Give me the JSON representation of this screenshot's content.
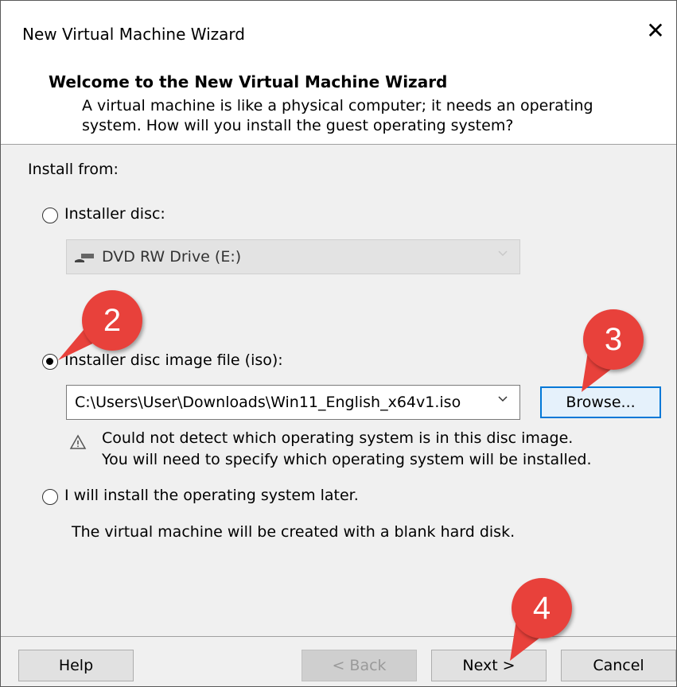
{
  "window": {
    "title": "New Virtual Machine Wizard",
    "close_glyph": "✕"
  },
  "header": {
    "title": "Welcome to the New Virtual Machine Wizard",
    "description_line1": "A virtual machine is like a physical computer; it needs an operating",
    "description_line2": "system. How will you install the guest operating system?"
  },
  "install": {
    "label": "Install from:",
    "options": [
      {
        "label": "Installer disc:",
        "selected": false
      },
      {
        "label": "Installer disc image file (iso):",
        "selected": true
      },
      {
        "label": "I will install the operating system later.",
        "selected": false
      }
    ],
    "disc_drive": {
      "value": "DVD RW Drive (E:)",
      "enabled": false
    },
    "iso_path": {
      "value": "C:\\Users\\User\\Downloads\\Win11_English_x64v1.iso"
    },
    "browse_label": "Browse...",
    "warning_line1": "Could not detect which operating system is in this disc image.",
    "warning_line2": "You will need to specify which operating system will be installed.",
    "later_note": "The virtual machine will be created with a blank hard disk."
  },
  "footer": {
    "help_label": "Help",
    "back_label": "< Back",
    "next_label": "Next >",
    "cancel_label": "Cancel"
  },
  "callouts": [
    "2",
    "3",
    "4"
  ],
  "colors": {
    "callout": "#e8413b",
    "primary_border": "#0078d7",
    "dialog_bg": "#f0f0f0"
  }
}
